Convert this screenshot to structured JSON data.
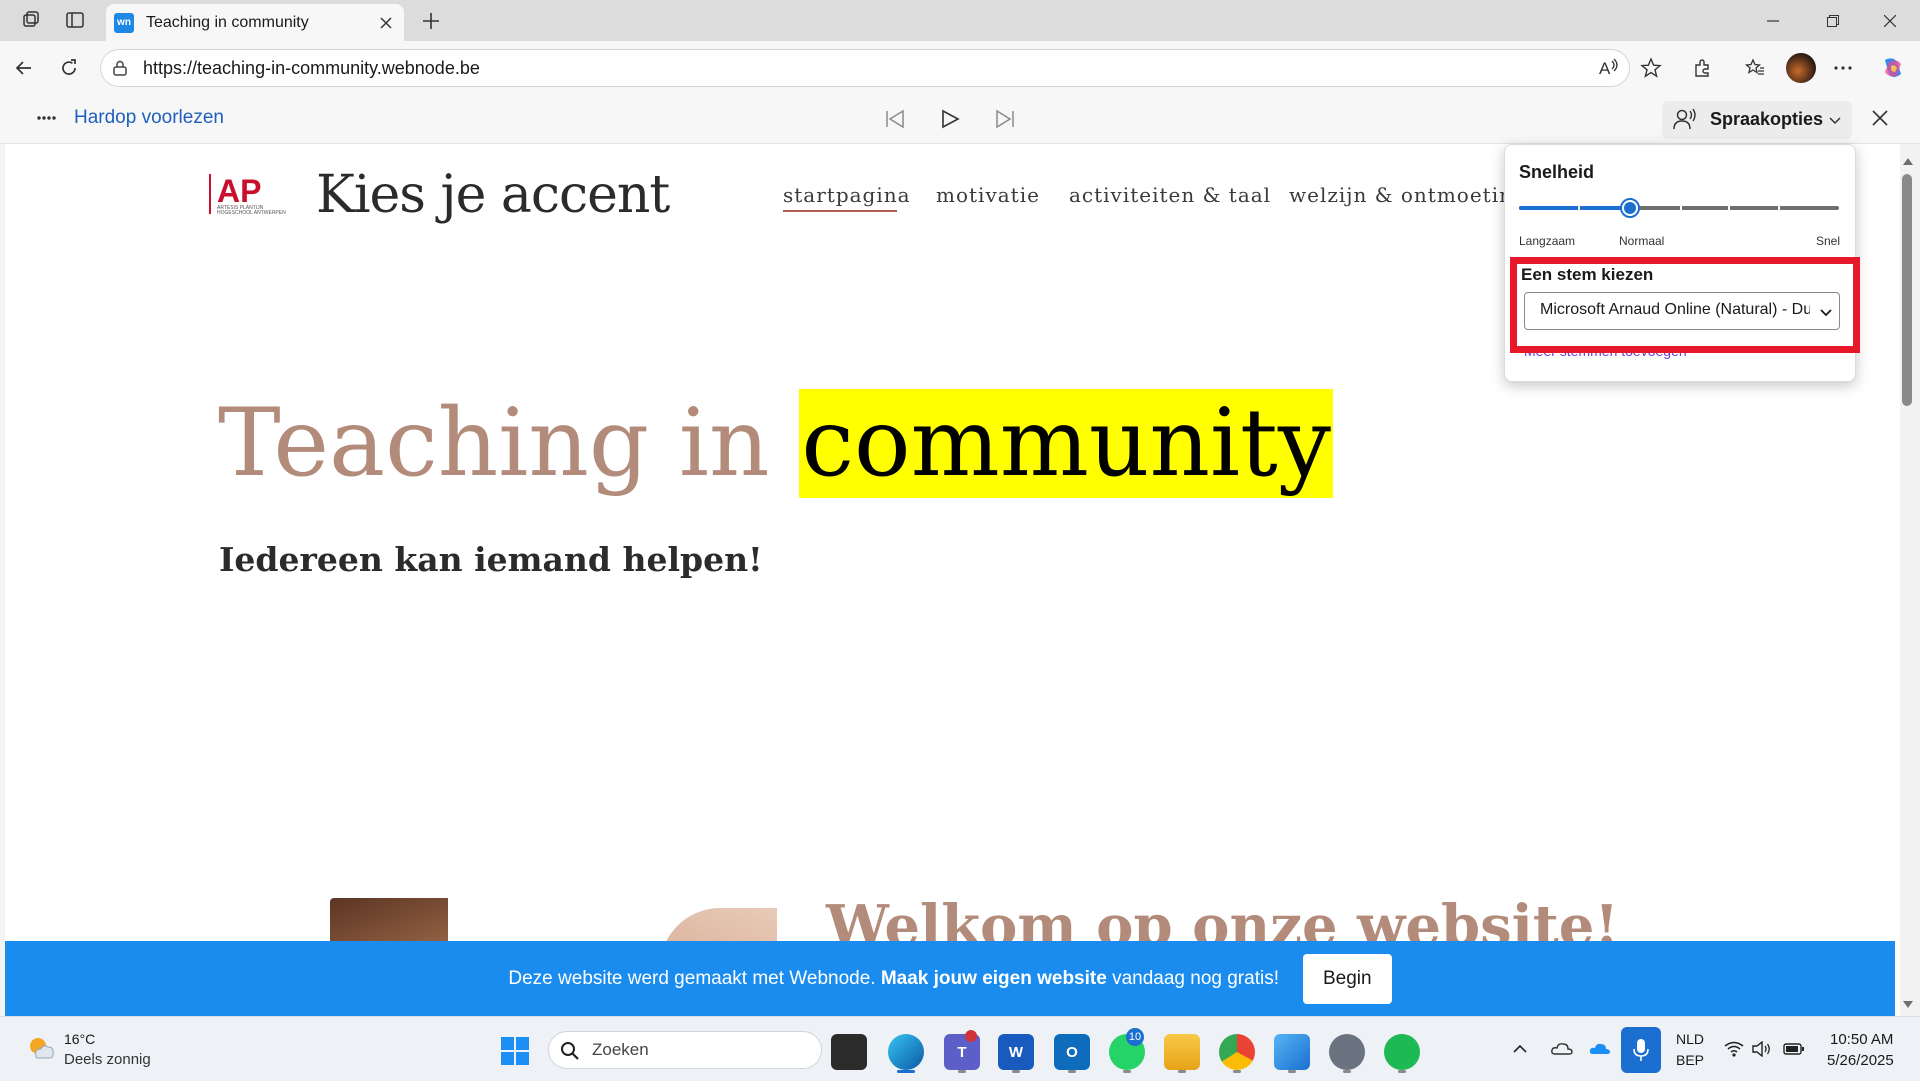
{
  "browser": {
    "tab": {
      "favicon_text": "wn",
      "title": "Teaching in community"
    },
    "url": "https://teaching-in-community.webnode.be"
  },
  "read_aloud": {
    "label": "Hardop voorlezen",
    "voice_options_label": "Spraakopties"
  },
  "voice_popup": {
    "speed_label": "Snelheid",
    "speed_value_fraction": 0.35,
    "speed_slow": "Langzaam",
    "speed_normal": "Normaal",
    "speed_fast": "Snel",
    "voice_label": "Een stem kiezen",
    "voice_selected": "Microsoft Arnaud Online (Natural) - Dutch (Netherlands)",
    "more_voices": "Meer stemmen toevoegen"
  },
  "site": {
    "logo_text": "AP",
    "logo_subtext": "ARTESIS PLANTIJN HOGESCHOOL ANTWERPEN",
    "title": "Kies je accent",
    "nav": [
      "startpagina",
      "motivatie",
      "activiteiten & taal",
      "welzijn & ontmoeting"
    ],
    "hero_plain": "Teaching in ",
    "hero_highlight": "community",
    "hero_subtitle": "Iedereen kan iemand helpen!",
    "welcome_title": "Welkom op onze website!"
  },
  "webnode_banner": {
    "text_before": "Deze website werd gemaakt met Webnode. ",
    "text_bold": "Maak jouw eigen website",
    "text_after": " vandaag nog gratis!",
    "button": "Begin"
  },
  "taskbar": {
    "weather_temp": "16°C",
    "weather_desc": "Deels zonnig",
    "search_placeholder": "Zoeken",
    "whatsapp_badge": "10",
    "lang_top": "NLD",
    "lang_bottom": "BEP",
    "time": "10:50 AM",
    "date": "5/26/2025"
  },
  "colors": {
    "accent": "#1b6fd1",
    "highlight": "#ffff00",
    "annotation_box": "#e8182b",
    "banner": "#1a8cf0",
    "hero_brown": "#b38b7b"
  }
}
